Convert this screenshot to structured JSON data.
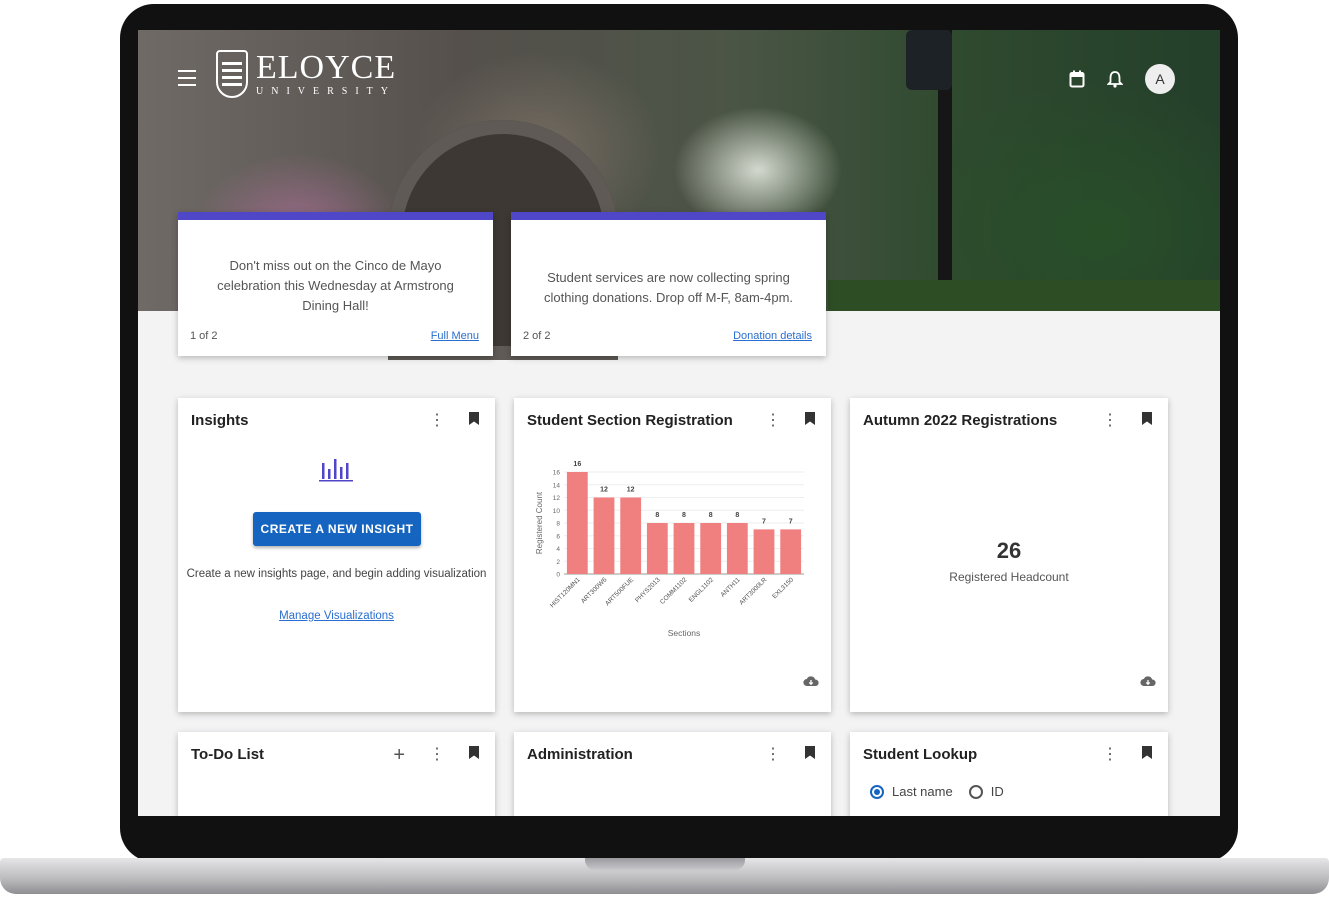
{
  "brand": {
    "name": "ELOYCE",
    "subtitle": "UNIVERSITY"
  },
  "header": {
    "avatar_initial": "A",
    "icons": [
      "calendar-icon",
      "bell-icon"
    ]
  },
  "announcements": [
    {
      "message": "Don't miss out on the Cinco de Mayo celebration this Wednesday at Armstrong Dining Hall!",
      "count": "1 of 2",
      "link": "Full Menu"
    },
    {
      "message": "Student services are now collecting spring clothing donations. Drop off M-F, 8am-4pm.",
      "count": "2 of 2",
      "link": "Donation details"
    }
  ],
  "insights": {
    "title": "Insights",
    "button": "CREATE A NEW INSIGHT",
    "description": "Create a new insights page, and begin adding visualization",
    "link": "Manage Visualizations"
  },
  "registration": {
    "title": "Student Section Registration"
  },
  "chart_data": {
    "type": "bar",
    "categories": [
      "HIST120MN1",
      "ART300W6",
      "ART500FUE",
      "PHYS2013",
      "COMM1102",
      "ENGL1102",
      "ANTH11",
      "ART3000LR",
      "EXL3150"
    ],
    "values": [
      16,
      12,
      12,
      8,
      8,
      8,
      8,
      7,
      7
    ],
    "xlabel": "Sections",
    "ylabel": "Registered Count",
    "ylim": [
      0,
      16
    ],
    "yticks": [
      0,
      2,
      4,
      6,
      8,
      10,
      12,
      14,
      16
    ],
    "color": "#f08080"
  },
  "autumn": {
    "title": "Autumn 2022 Registrations",
    "count": "26",
    "label": "Registered Headcount"
  },
  "todo": {
    "title": "To-Do List",
    "add": "+"
  },
  "administration": {
    "title": "Administration"
  },
  "lookup": {
    "title": "Student Lookup",
    "option_last_name": "Last name",
    "option_id": "ID"
  },
  "colors": {
    "accent": "#5046c8",
    "primary_button": "#1565c0",
    "link": "#2a6fd0",
    "bar": "#f08080"
  }
}
